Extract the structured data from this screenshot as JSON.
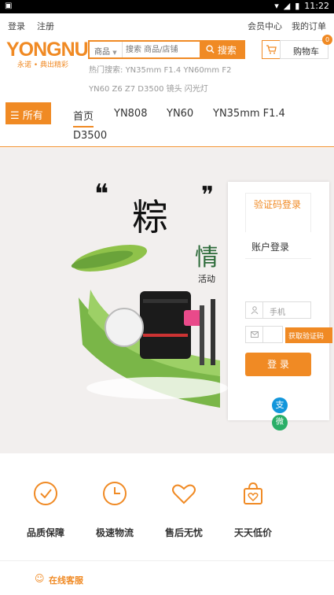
{
  "statusbar": {
    "icon": "android-icon",
    "time": "11:22"
  },
  "topbar": {
    "login": "登录",
    "register": "注册",
    "member_center": "会员中心",
    "my_orders": "我的订单"
  },
  "logo": {
    "wordmark": "YONGNUO",
    "slogan": "永诺 • 典出精彩"
  },
  "search": {
    "category": "商品",
    "placeholder": "搜索 商品/店铺",
    "button": "搜索"
  },
  "cart": {
    "label": "购物车",
    "count": "0"
  },
  "hot_search": {
    "prefix": "热门搜索:",
    "line1": "YN35mm F1.4 YN60mm F2",
    "line2": "YN60 Z6 Z7 D3500 镜头 闪光灯"
  },
  "nav": {
    "all": "所有",
    "items": [
      "首页",
      "YN808",
      "YN60",
      "YN35mm F1.4",
      "D3500"
    ]
  },
  "banner": {
    "big_char": "粽",
    "side_char": "情",
    "sub": "活动"
  },
  "login": {
    "tab_code": "验证码登录",
    "title": "账户登录",
    "phone_placeholder": "手机",
    "get_code": "获取验证码",
    "submit": "登 录",
    "alipay_glyph": "支",
    "wechat_glyph": "微"
  },
  "features": [
    "品质保障",
    "极速物流",
    "售后无忧",
    "天天低价"
  ],
  "footer": {
    "online_service": "在线客服"
  },
  "colors": {
    "accent": "#f08a24"
  }
}
